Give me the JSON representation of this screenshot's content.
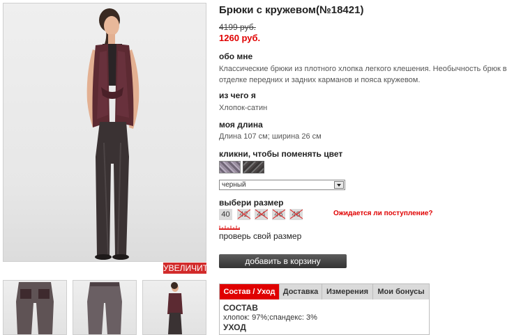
{
  "gallery": {
    "zoom_label": "УВЕЛИЧИТЬ"
  },
  "product": {
    "title": "Брюки с кружевом(№18421)",
    "old_price": "4199 руб.",
    "new_price": "1260 руб.",
    "about_label": "обо мне",
    "about_text": "Классические брюки из плотного хлопка легкого клешения. Необычность брюк в отделке передних и задних карманов и пояса кружевом.",
    "material_label": "из чего я",
    "material_text": "Хлопок-сатин",
    "length_label": "моя длина",
    "length_text": "Длина 107 см; ширина 26 см"
  },
  "color": {
    "label": "кликни, чтобы поменять цвет",
    "selected": "черный"
  },
  "size": {
    "label": "выбери размер",
    "options": [
      "40",
      "42",
      "44",
      "46",
      "48"
    ],
    "restock_link": "Ожидается ли поступление?",
    "check_size_link": "проверь свой размер"
  },
  "cart": {
    "add_label": "добавить в корзину"
  },
  "tabs": {
    "items": [
      "Состав / Уход",
      "Доставка",
      "Измерения",
      "Мои бонусы"
    ],
    "content": {
      "composition_heading": "СОСТАВ",
      "composition_text": "хлопок: 97%;спандекс: 3%",
      "care_heading": "УХОД"
    }
  },
  "colors": {
    "accent_red": "#e00000",
    "button_dark": "#444444",
    "tab_inactive": "#dadada"
  }
}
